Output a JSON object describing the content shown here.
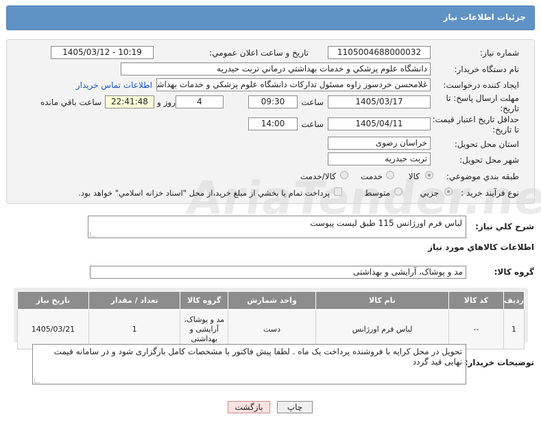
{
  "page": {
    "title": "جزئيات اطلاعات نياز"
  },
  "form": {
    "need_number": {
      "label": "شماره نياز:",
      "value": "1105004688000032"
    },
    "announce_datetime": {
      "label": "تاريخ و ساعت اعلان عمومي:",
      "value": "1405/03/12 - 10:19"
    },
    "buyer_org": {
      "label": "نام دستگاه خريدار:",
      "value": "دانشگاه علوم پزشكي و خدمات بهداشتي درماني تربت حيدريه"
    },
    "requester": {
      "label": "ايجاد كننده درخواست:",
      "value": "غلامحسن خردسوز زاوه مسئول تداركات دانشگاه علوم پزشكي و خدمات بهداشتي",
      "contact_link": "اطلاعات تماس خريدار"
    },
    "reply_deadline": {
      "label_line1": "مهلت ارسال پاسخ: تا",
      "label_line2": "تاريخ:",
      "date": "1405/03/17",
      "time_label": "ساعت",
      "time": "09:30",
      "days": "4",
      "days_label": "روز و",
      "remaining": "22:41:48",
      "remaining_label": "ساعت باقي مانده"
    },
    "price_validity": {
      "label_line1": "حداقل تاريخ اعتبار قيمت:",
      "label_line2": "تا تاريخ:",
      "date": "1405/04/11",
      "time_label": "ساعت",
      "time": "14:00"
    },
    "delivery_province": {
      "label": "استان محل تحويل:",
      "value": "خراسان رضوی"
    },
    "delivery_city": {
      "label": "شهر محل تحويل:",
      "value": "تربت حيدريه"
    },
    "category": {
      "label": "طبقه بندي موضوعي:",
      "options": [
        "كالا",
        "خدمت",
        "كالا/خدمت"
      ],
      "selected": "كالا"
    },
    "purchase_type": {
      "label": "نوع فرآيند خريد :",
      "options": [
        "جزيي",
        "متوسط"
      ],
      "selected": "جزيي",
      "checkbox_label": "پرداخت تمام يا بخشي از مبلغ خريد،از محل \"اسناد خزانه اسلامي\" خواهد بود."
    }
  },
  "summary": {
    "label": "شرح كلي نياز:",
    "value": "لباس فرم اورژانس 115 طبق لیست پیوست"
  },
  "goods_info": {
    "title": "اطلاعات كالاهاي مورد نياز"
  },
  "goods_group": {
    "label": "گروه كالا:",
    "value": "مد و پوشاک، آرایشی و بهداشتی"
  },
  "table": {
    "headers": [
      "رديف",
      "كد كالا",
      "نام كالا",
      "واحد شمارش",
      "گروه كالا",
      "تعداد / مقدار",
      "تاريخ نياز"
    ],
    "rows": [
      {
        "row": "1",
        "code": "--",
        "name": "لباس فرم اورژانس",
        "unit": "دست",
        "group_l1": "مد و پوشاک،",
        "group_l2": "آرایشی و",
        "group_l3": "بهداشتی",
        "qty": "1",
        "date": "1405/03/21"
      }
    ]
  },
  "buyer_notes": {
    "label": "توضيحات خريدار:",
    "line1": "تحویل در محل کرایه با فروشنده  پرداخت  یک ماه . لطفا پیش فاکتور با مشخصات کامل بارگزاری شود و در سامانه قیمت",
    "line2": "نهایی قید گردد"
  },
  "buttons": {
    "print": "چاپ",
    "back": "بازگشت"
  },
  "watermark": "AriaTender.net"
}
